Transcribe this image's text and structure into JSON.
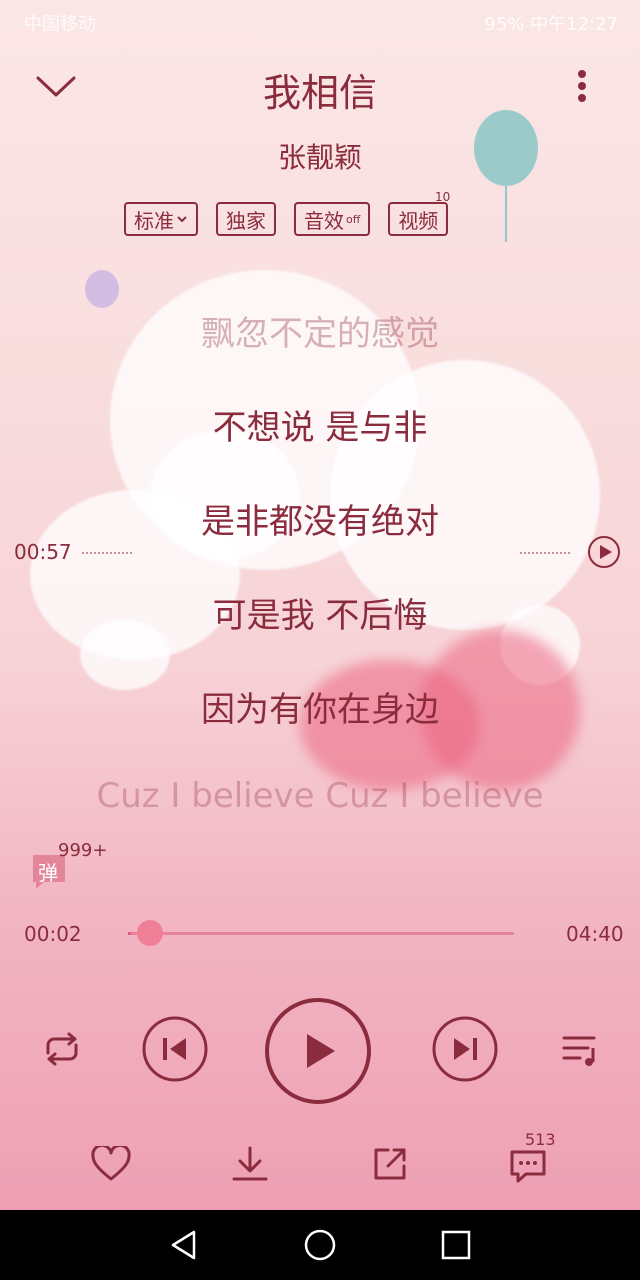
{
  "status_bar": {
    "left_text": "中国移动",
    "right_text": "95% 中午12:27"
  },
  "song": {
    "title": "我相信",
    "artist": "张靓颖"
  },
  "tags": {
    "quality": "标准",
    "exclusive": "独家",
    "effect": "音效",
    "effect_state": "off",
    "video": "视频",
    "video_count": "10"
  },
  "lyrics": [
    "飘忽不定的感觉",
    "不想说 是与非",
    "是非都没有绝对",
    "可是我 不后悔",
    "因为有你在身边",
    "Cuz I believe Cuz I believe"
  ],
  "seek_marker": {
    "time": "00:57"
  },
  "danmu": {
    "label": "弹",
    "count": "999+"
  },
  "progress": {
    "current": "00:02",
    "total": "04:40",
    "fraction": 0.007
  },
  "comments_count": "513",
  "colors": {
    "accent": "#8b2c3e",
    "progress": "#e65a7a",
    "thumb": "#ee7f97"
  },
  "icons": {
    "collapse": "chevron-down-icon",
    "more": "more-vertical-icon",
    "repeat": "repeat-icon",
    "prev": "skip-previous-icon",
    "play": "play-icon",
    "next": "skip-next-icon",
    "playlist": "playlist-icon",
    "like": "heart-icon",
    "download": "download-icon",
    "share": "share-icon",
    "comments": "comment-icon"
  }
}
